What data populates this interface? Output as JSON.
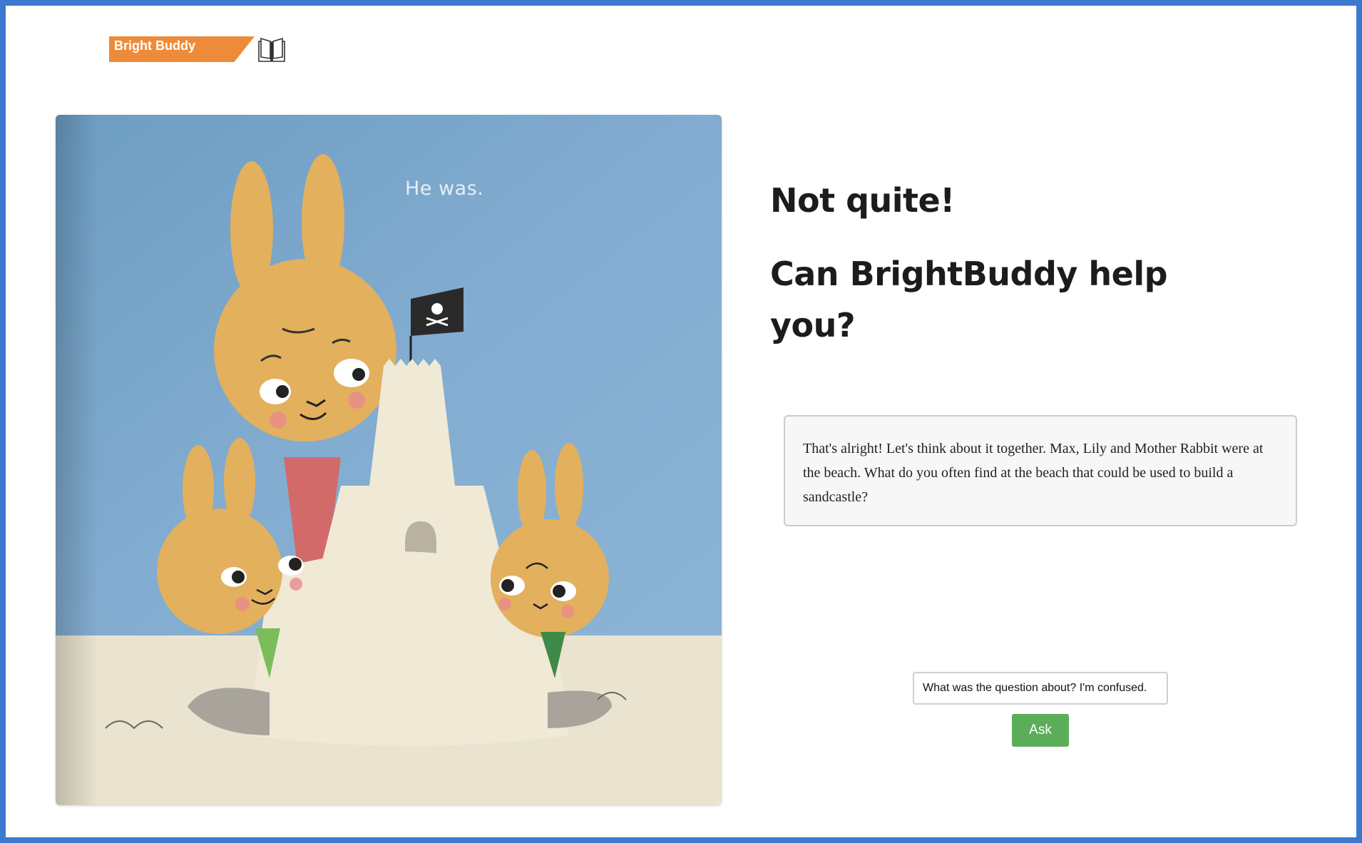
{
  "brand": {
    "name": "Bright Buddy",
    "icon": "open-book-icon",
    "color": "#ee8b3a"
  },
  "book": {
    "page_text": "He was."
  },
  "feedback": {
    "title": "Not quite!",
    "prompt": "Can BrightBuddy help you?"
  },
  "assistant": {
    "response": "That's alright! Let's think about it together. Max, Lily and Mother Rabbit were at the beach. What do you often find at the beach that could be used to build a sandcastle?"
  },
  "question": {
    "value": "What was the question about? I'm confused.",
    "ask_label": "Ask",
    "ask_color": "#5cad5a"
  }
}
